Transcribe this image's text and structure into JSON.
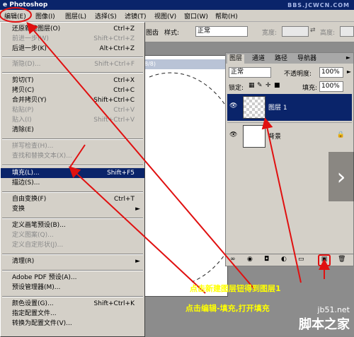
{
  "window": {
    "title": "e Photoshop",
    "watermark_top": "BBS.JCWCN.COM"
  },
  "menubar": {
    "items": [
      "编辑(E)",
      "图像(I)",
      "图层(L)",
      "选择(S)",
      "滤镜(T)",
      "视图(V)",
      "窗口(W)",
      "帮助(H)"
    ]
  },
  "options_bar": {
    "partial_label": "图齿",
    "style_label": "样式:",
    "style_value": "正常",
    "width_label": "宽度:",
    "height_label": "高度:"
  },
  "doc": {
    "title": "8/8)"
  },
  "edit_menu": {
    "items": [
      {
        "label": "还原新建图层(O)",
        "shortcut": "Ctrl+Z"
      },
      {
        "label": "前进一步(W)",
        "shortcut": "Shift+Ctrl+Z",
        "disabled": true
      },
      {
        "label": "后退一步(K)",
        "shortcut": "Alt+Ctrl+Z"
      },
      {
        "label": "渐隐(D)...",
        "shortcut": "Shift+Ctrl+F",
        "disabled": true
      },
      {
        "label": "剪切(T)",
        "shortcut": "Ctrl+X"
      },
      {
        "label": "拷贝(C)",
        "shortcut": "Ctrl+C"
      },
      {
        "label": "合并拷贝(Y)",
        "shortcut": "Shift+Ctrl+C"
      },
      {
        "label": "粘贴(P)",
        "shortcut": "Ctrl+V",
        "disabled": true
      },
      {
        "label": "贴入(I)",
        "shortcut": "Shift+Ctrl+V",
        "disabled": true
      },
      {
        "label": "清除(E)",
        "shortcut": ""
      },
      {
        "label": "拼写检查(H)...",
        "shortcut": "",
        "disabled": true
      },
      {
        "label": "查找和替换文本(X)...",
        "shortcut": "",
        "disabled": true
      },
      {
        "label": "填充(L)...",
        "shortcut": "Shift+F5",
        "highlighted": true
      },
      {
        "label": "描边(S)...",
        "shortcut": ""
      },
      {
        "label": "自由变换(F)",
        "shortcut": "Ctrl+T"
      },
      {
        "label": "变换",
        "shortcut": "",
        "submenu": true
      },
      {
        "label": "定义画笔预设(B)...",
        "shortcut": ""
      },
      {
        "label": "定义图案(Q)...",
        "shortcut": "",
        "disabled": true
      },
      {
        "label": "定义自定形状(J)...",
        "shortcut": "",
        "disabled": true
      },
      {
        "label": "清理(R)",
        "shortcut": "",
        "submenu": true
      },
      {
        "label": "Adobe PDF 预设(A)...",
        "shortcut": ""
      },
      {
        "label": "预设管理器(M)...",
        "shortcut": ""
      },
      {
        "label": "颜色设置(G)...",
        "shortcut": "Shift+Ctrl+K"
      },
      {
        "label": "指定配置文件...",
        "shortcut": ""
      },
      {
        "label": "转换为配置文件(V)...",
        "shortcut": ""
      }
    ]
  },
  "layers_panel": {
    "tabs": [
      "图层",
      "通道",
      "路径",
      "导航器"
    ],
    "blend_mode": "正常",
    "opacity_label": "不透明度:",
    "opacity_value": "100%",
    "lock_label": "锁定:",
    "fill_label": "填充:",
    "fill_value": "100%",
    "layers": [
      {
        "name": "图层 1",
        "selected": true
      },
      {
        "name": "背景",
        "selected": false
      }
    ]
  },
  "annotations": {
    "note1": "点击新建图层钮得到图层1",
    "note2": "点击编辑-填充,打开填充"
  },
  "watermark": {
    "line1": "jb51.net",
    "line2": "脚本之家"
  },
  "colors": {
    "annotation": "#ffff00",
    "arrow": "#e01010",
    "selection": "#0a246a"
  }
}
